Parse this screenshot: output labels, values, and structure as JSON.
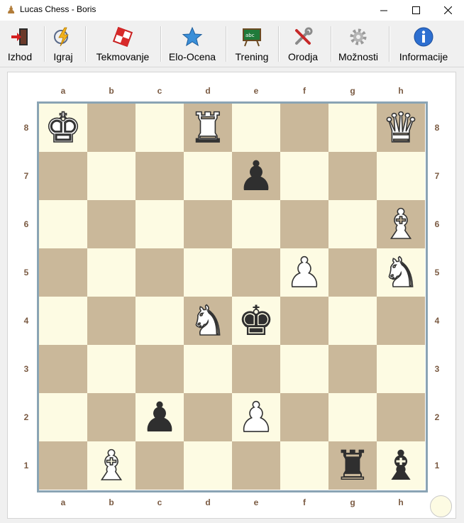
{
  "window": {
    "title": "Lucas Chess - Boris",
    "app_icon": "chess-pawn-icon"
  },
  "toolbar": {
    "items": [
      {
        "label": "Izhod",
        "icon": "exit-door-icon"
      },
      {
        "label": "Igraj",
        "icon": "play-lightning-icon"
      },
      {
        "label": "Tekmovanje",
        "icon": "competition-board-icon"
      },
      {
        "label": "Elo-Ocena",
        "icon": "star-icon"
      },
      {
        "label": "Trening",
        "icon": "training-chalkboard-icon"
      },
      {
        "label": "Orodja",
        "icon": "tools-icon"
      },
      {
        "label": "Možnosti",
        "icon": "gear-icon"
      },
      {
        "label": "Informacije",
        "icon": "info-icon"
      }
    ]
  },
  "board": {
    "files": [
      "a",
      "b",
      "c",
      "d",
      "e",
      "f",
      "g",
      "h"
    ],
    "ranks": [
      "8",
      "7",
      "6",
      "5",
      "4",
      "3",
      "2",
      "1"
    ],
    "colors": {
      "light": "#fdfbe3",
      "dark": "#cab89a",
      "border": "#8aa4b4"
    },
    "pieces": {
      "a8": {
        "glyph": "♚",
        "color": "w",
        "name": "white-king"
      },
      "d8": {
        "glyph": "♜",
        "color": "w",
        "name": "white-rook"
      },
      "h8": {
        "glyph": "♛",
        "color": "w",
        "name": "white-queen"
      },
      "e7": {
        "glyph": "♟",
        "color": "b",
        "name": "black-pawn"
      },
      "h6": {
        "glyph": "♝",
        "color": "w",
        "name": "white-bishop"
      },
      "f5": {
        "glyph": "♟",
        "color": "w",
        "name": "white-pawn"
      },
      "h5": {
        "glyph": "♞",
        "color": "w",
        "name": "white-knight"
      },
      "d4": {
        "glyph": "♞",
        "color": "w",
        "name": "white-knight"
      },
      "e4": {
        "glyph": "♚",
        "color": "b",
        "name": "black-king"
      },
      "c2": {
        "glyph": "♟",
        "color": "b",
        "name": "black-pawn"
      },
      "e2": {
        "glyph": "♟",
        "color": "w",
        "name": "white-pawn"
      },
      "b1": {
        "glyph": "♝",
        "color": "w",
        "name": "white-bishop"
      },
      "g1": {
        "glyph": "♜",
        "color": "b",
        "name": "black-rook"
      },
      "h1": {
        "glyph": "♝",
        "color": "b",
        "name": "black-bishop"
      }
    },
    "side_to_move": "white"
  }
}
